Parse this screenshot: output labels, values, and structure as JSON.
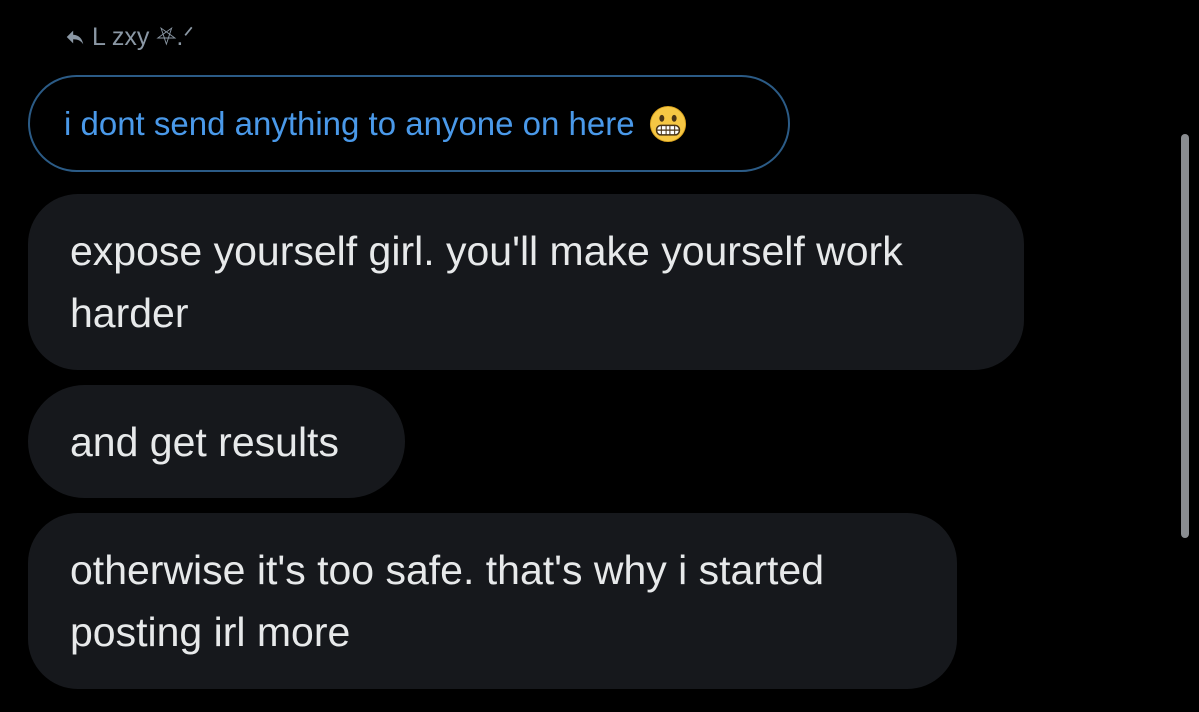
{
  "reply_header": {
    "icon": "reply-arrow-icon",
    "text": "L zxy ⛧.ᐟ"
  },
  "quoted_message": {
    "text": "i dont send anything to anyone on here",
    "emoji": "grimacing-face-icon"
  },
  "messages": [
    {
      "text": "expose yourself girl. you'll make yourself work harder"
    },
    {
      "text": "and get results"
    },
    {
      "text": "otherwise it's too safe. that's why i started posting irl more"
    }
  ],
  "colors": {
    "background": "#000000",
    "bubble": "#16181c",
    "text": "#e7e9ea",
    "link_blue": "#4a99e9",
    "quote_border": "#2b5b86",
    "muted": "#8b98a5"
  }
}
